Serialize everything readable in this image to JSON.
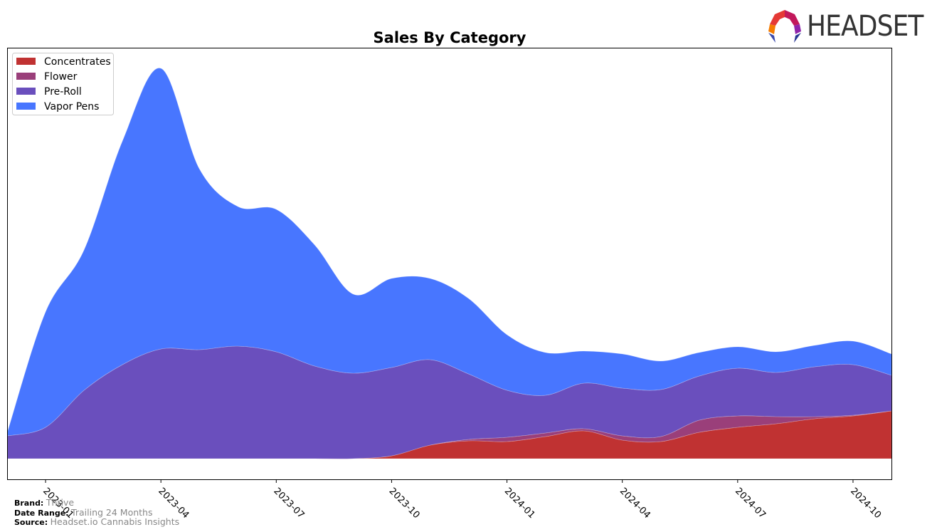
{
  "header": {
    "logo_text": "HEADSET"
  },
  "footer": {
    "brand_label": "Brand:",
    "brand_value": "Thrive",
    "date_range_label": "Date Range:",
    "date_range_value": "Trailing 24 Months",
    "source_label": "Source:",
    "source_value": "Headset.io Cannabis Insights"
  },
  "chart_data": {
    "type": "area",
    "stacked": true,
    "smooth": true,
    "title": "Sales By Category",
    "xlabel": "",
    "ylabel": "",
    "y_units": "relative (no y-axis ticks shown)",
    "grid": false,
    "legend_position": "top-left",
    "x": [
      "2022-12",
      "2023-01",
      "2023-02",
      "2023-03",
      "2023-04",
      "2023-05",
      "2023-06",
      "2023-07",
      "2023-08",
      "2023-09",
      "2023-10",
      "2023-11",
      "2023-12",
      "2024-01",
      "2024-02",
      "2024-03",
      "2024-04",
      "2024-05",
      "2024-06",
      "2024-07",
      "2024-08",
      "2024-09",
      "2024-10",
      "2024-11"
    ],
    "x_tick_labels": [
      "2023-01",
      "2023-04",
      "2023-07",
      "2023-10",
      "2024-01",
      "2024-04",
      "2024-07",
      "2024-10"
    ],
    "ylim": [
      -29,
      577
    ],
    "series": [
      {
        "name": "Concentrates",
        "color": "#c03232",
        "values": [
          0,
          0,
          0,
          0,
          0,
          0,
          0,
          0,
          0,
          0,
          4,
          19,
          25,
          24,
          31,
          39,
          26,
          24,
          37,
          44,
          49,
          56,
          60,
          67
        ]
      },
      {
        "name": "Flower",
        "color": "#9a3f7a",
        "values": [
          0,
          0,
          0,
          0,
          0,
          0,
          0,
          0,
          0,
          0,
          0,
          0,
          2,
          6,
          5,
          3,
          6,
          7,
          17,
          16,
          10,
          3,
          1,
          0
        ]
      },
      {
        "name": "Pre-Roll",
        "color": "#6a4fbd",
        "values": [
          32,
          44,
          96,
          132,
          154,
          153,
          158,
          150,
          130,
          120,
          124,
          120,
          92,
          66,
          53,
          64,
          67,
          66,
          62,
          67,
          62,
          70,
          71,
          50
        ]
      },
      {
        "name": "Vapor Pens",
        "color": "#4876ff",
        "values": [
          4,
          162,
          197,
          314,
          394,
          254,
          196,
          200,
          170,
          111,
          125,
          114,
          106,
          78,
          60,
          45,
          48,
          40,
          33,
          30,
          29,
          30,
          33,
          30
        ]
      }
    ]
  }
}
